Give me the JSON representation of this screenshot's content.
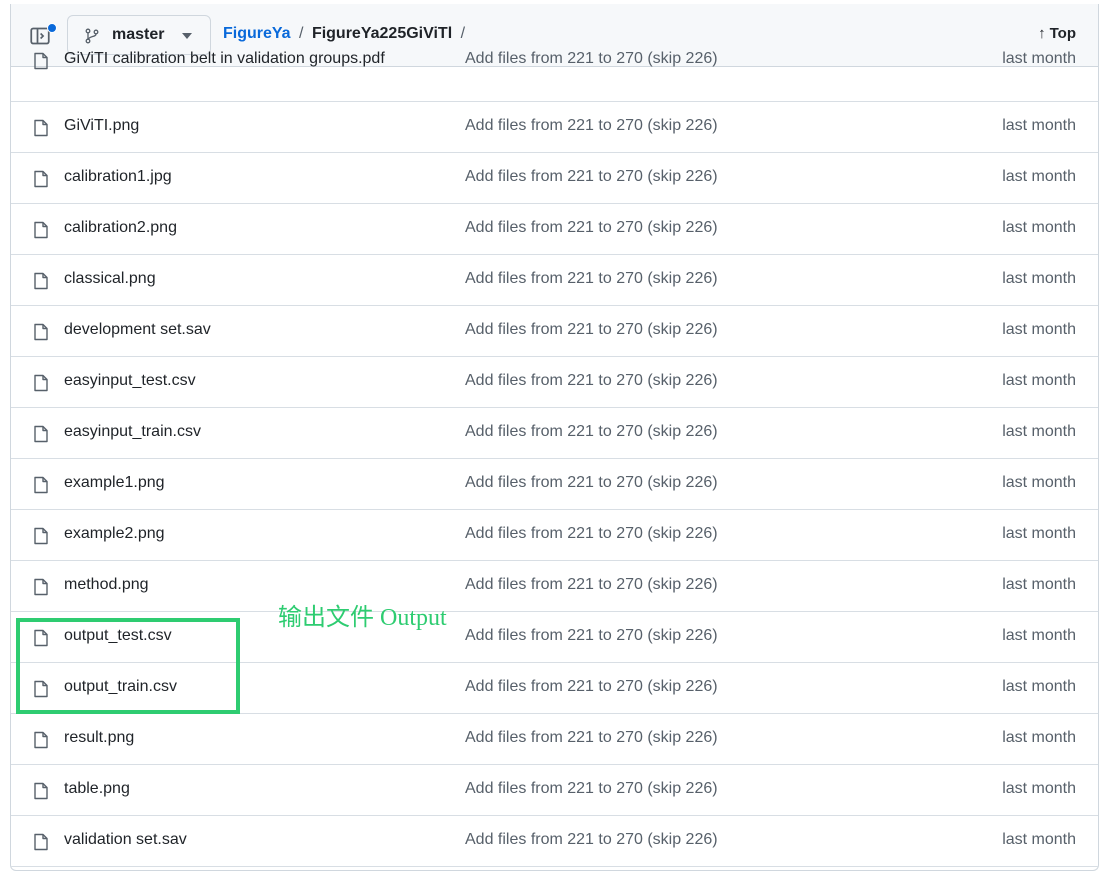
{
  "header": {
    "branch": "master",
    "breadcrumb": {
      "repo": "FigureYa",
      "separator": "/",
      "current": "FigureYa225GiViTl",
      "trailing": "/"
    },
    "top_label": "Top",
    "top_arrow": "↑"
  },
  "files": [
    {
      "name": "GiViTI calibration belt in validation groups.pdf",
      "message": "Add files from 221 to 270 (skip 226)",
      "age": "last month"
    },
    {
      "name": "GiViTI.png",
      "message": "Add files from 221 to 270 (skip 226)",
      "age": "last month"
    },
    {
      "name": "calibration1.jpg",
      "message": "Add files from 221 to 270 (skip 226)",
      "age": "last month"
    },
    {
      "name": "calibration2.png",
      "message": "Add files from 221 to 270 (skip 226)",
      "age": "last month"
    },
    {
      "name": "classical.png",
      "message": "Add files from 221 to 270 (skip 226)",
      "age": "last month"
    },
    {
      "name": "development set.sav",
      "message": "Add files from 221 to 270 (skip 226)",
      "age": "last month"
    },
    {
      "name": "easyinput_test.csv",
      "message": "Add files from 221 to 270 (skip 226)",
      "age": "last month"
    },
    {
      "name": "easyinput_train.csv",
      "message": "Add files from 221 to 270 (skip 226)",
      "age": "last month"
    },
    {
      "name": "example1.png",
      "message": "Add files from 221 to 270 (skip 226)",
      "age": "last month"
    },
    {
      "name": "example2.png",
      "message": "Add files from 221 to 270 (skip 226)",
      "age": "last month"
    },
    {
      "name": "method.png",
      "message": "Add files from 221 to 270 (skip 226)",
      "age": "last month"
    },
    {
      "name": "output_test.csv",
      "message": "Add files from 221 to 270 (skip 226)",
      "age": "last month"
    },
    {
      "name": "output_train.csv",
      "message": "Add files from 221 to 270 (skip 226)",
      "age": "last month"
    },
    {
      "name": "result.png",
      "message": "Add files from 221 to 270 (skip 226)",
      "age": "last month"
    },
    {
      "name": "table.png",
      "message": "Add files from 221 to 270 (skip 226)",
      "age": "last month"
    },
    {
      "name": "validation set.sav",
      "message": "Add files from 221 to 270 (skip 226)",
      "age": "last month"
    }
  ],
  "annotation": {
    "text": "输出文件 Output",
    "color": "#2ecc71"
  },
  "colors": {
    "link": "#0969da",
    "muted": "#57606a",
    "border": "#d0d7de"
  }
}
